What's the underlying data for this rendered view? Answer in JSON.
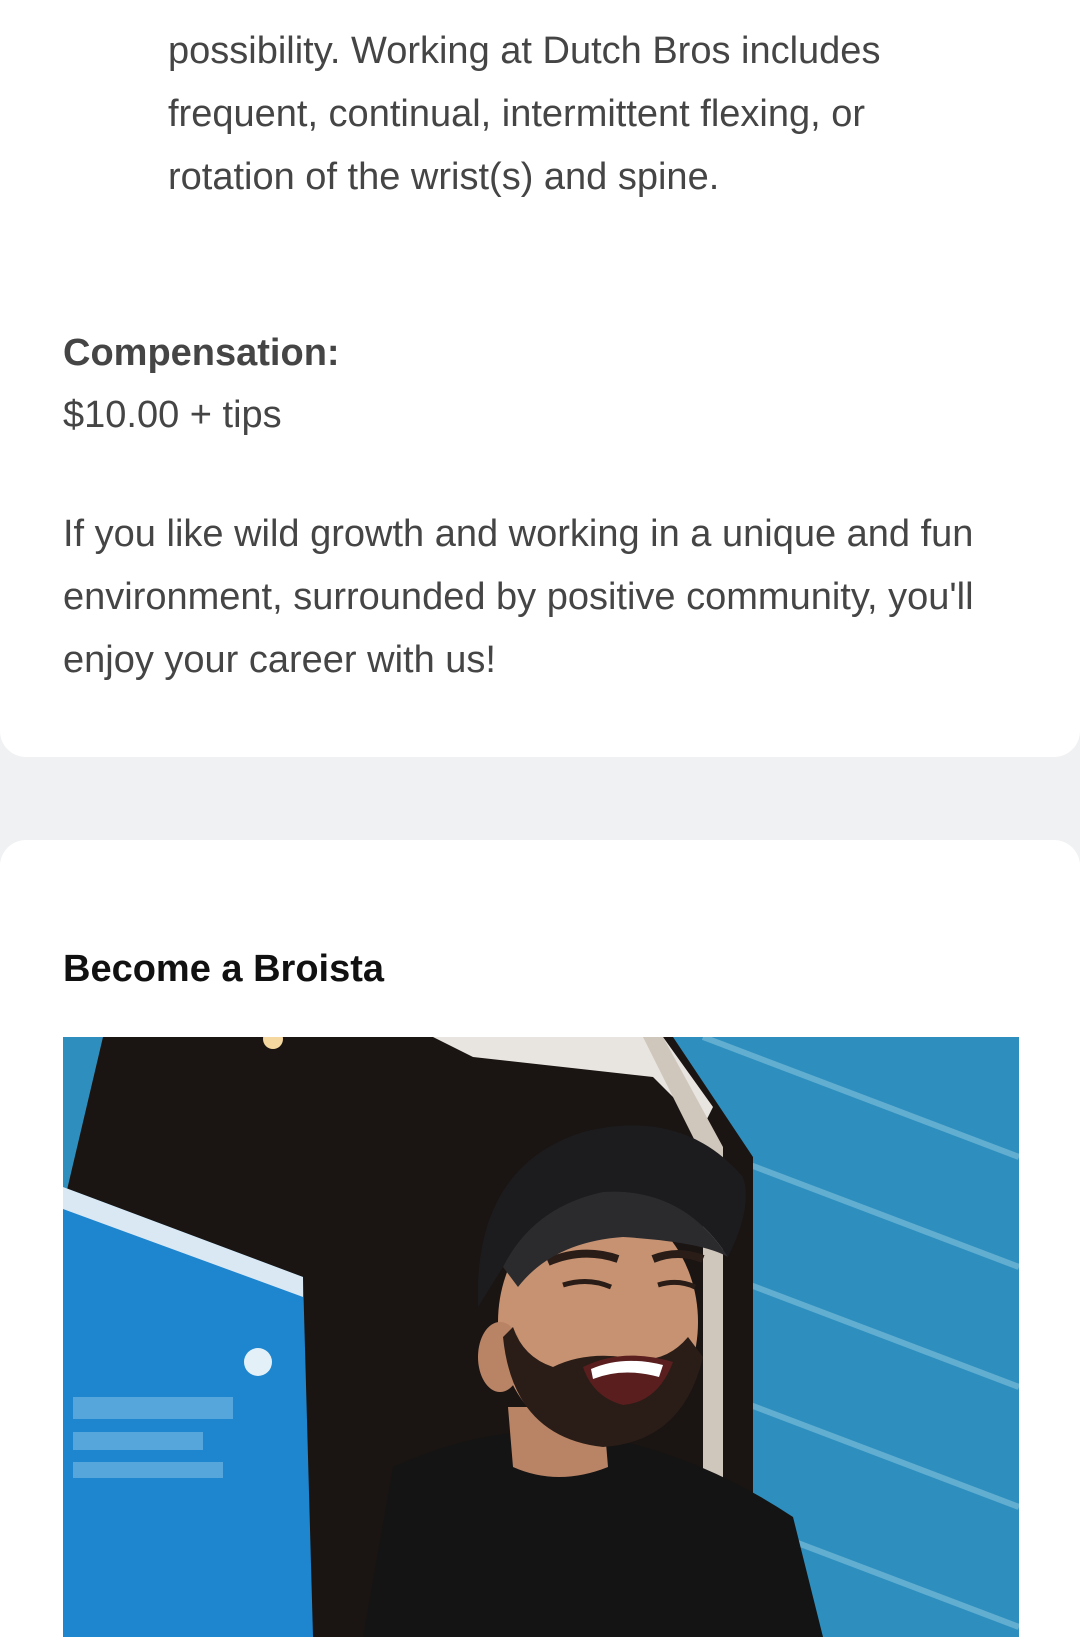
{
  "description": {
    "bullet_text": "possibility. Working at Dutch Bros includes frequent, continual, intermittent flexing, or rotation of the wrist(s) and spine.",
    "compensation_label": "Compensation:",
    "compensation_value": "$10.00 + tips",
    "outro": "If you like wild growth and working in a unique and fun environment, surrounded by positive community, you'll enjoy your career with us!"
  },
  "section": {
    "title": "Become a Broista",
    "image_alt": "Smiling man in a cap at a coffee stand window"
  }
}
